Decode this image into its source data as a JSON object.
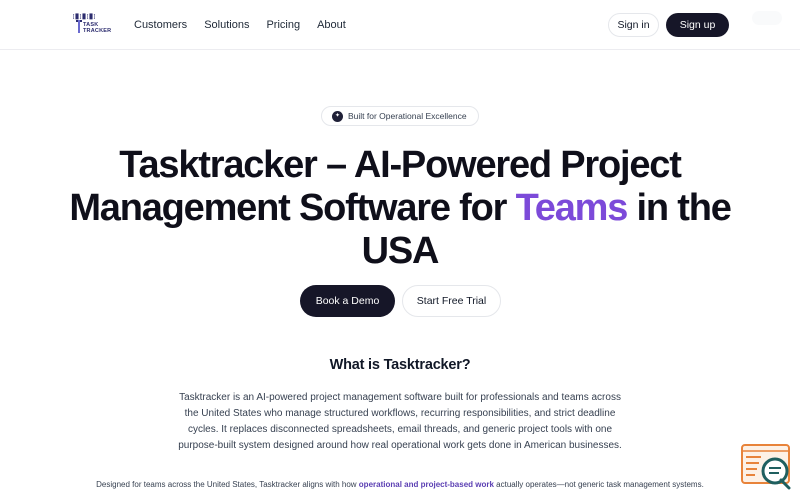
{
  "header": {
    "logo": {
      "top_text": "[█]█[█]",
      "text_line1": "TASK",
      "text_line2": "TRACKER"
    },
    "nav": [
      {
        "label": "Customers"
      },
      {
        "label": "Solutions"
      },
      {
        "label": "Pricing"
      },
      {
        "label": "About"
      }
    ],
    "signin_label": "Sign in",
    "signup_label": "Sign up"
  },
  "hero": {
    "badge_text": "Built for Operational Excellence",
    "badge_icon": "sparkle-icon",
    "title_before": "Tasktracker – AI-Powered Project Management Software for ",
    "title_accent": "Teams",
    "title_after": " in the USA",
    "primary_cta": "Book a Demo",
    "secondary_cta": "Start Free Trial"
  },
  "about": {
    "title": "What is Tasktracker?",
    "body": "Tasktracker is an AI-powered project management software built for professionals and teams across the United States who manage structured workflows, recurring responsibilities, and strict deadline cycles. It replaces disconnected spreadsheets, email threads, and generic project tools with one purpose-built system designed around how real operational work gets done in American businesses.",
    "footer_before": "Designed for teams across the United States, Tasktracker aligns with how ",
    "footer_link": "operational and project-based work",
    "footer_after": " actually operates—not generic task management systems."
  },
  "colors": {
    "accent": "#7c4ad9",
    "primary_dark": "#161628",
    "chat_orange": "#e8833a",
    "chat_teal": "#1f5f5f"
  },
  "icons": {
    "chat": "chat-support-icon"
  }
}
